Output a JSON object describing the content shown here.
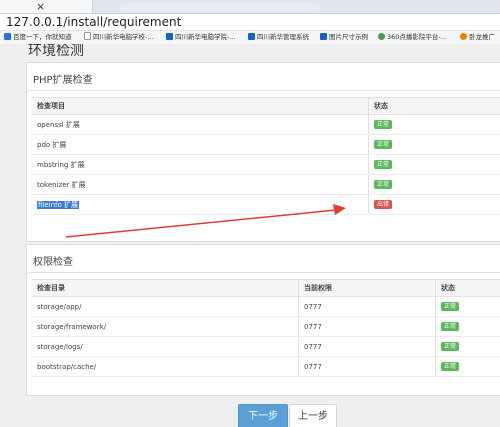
{
  "browser": {
    "url": "127.0.0.1/install/requirement",
    "tab_close": "×",
    "bookmarks": [
      {
        "label": "百度一下，你就知道",
        "color": "#2b6de5"
      },
      {
        "label": "四川新华电脑学校-...",
        "color": "#999999"
      },
      {
        "label": "四川新华电脑学院-...",
        "color": "#1565c0"
      },
      {
        "label": "四川新华管理系统",
        "color": "#1565c0"
      },
      {
        "label": "图片尺寸示例",
        "color": "#1565c0"
      },
      {
        "label": "360点播影院平台-...",
        "color": "#43a047"
      },
      {
        "label": "卧龙推广",
        "color": "#f57c00"
      }
    ]
  },
  "page": {
    "title": "环境检测",
    "php_section": {
      "title": "PHP扩展检查",
      "columns": [
        "检查项目",
        "状态"
      ],
      "rows": [
        {
          "name": "openssl 扩展",
          "status": "正常",
          "state": "ok"
        },
        {
          "name": "pdo 扩展",
          "status": "正常",
          "state": "ok"
        },
        {
          "name": "mbstring 扩展",
          "status": "正常",
          "state": "ok"
        },
        {
          "name": "tokenizer 扩展",
          "status": "正常",
          "state": "ok"
        },
        {
          "name": "fileinfo 扩展",
          "status": "出错",
          "state": "err"
        }
      ]
    },
    "perm_section": {
      "title": "权限检查",
      "columns": [
        "检查目录",
        "当前权限",
        "状态"
      ],
      "rows": [
        {
          "dir": "storage/app/",
          "perm": "0777",
          "status": "正常"
        },
        {
          "dir": "storage/framework/",
          "perm": "0777",
          "status": "正常"
        },
        {
          "dir": "storage/logs/",
          "perm": "0777",
          "status": "正常"
        },
        {
          "dir": "bootstrap/cache/",
          "perm": "0777",
          "status": "正常"
        }
      ]
    },
    "buttons": {
      "next": "下一步",
      "prev": "上一步"
    }
  },
  "colors": {
    "ok": "#5cb85c",
    "err": "#d9534f",
    "primary": "#5a9fd6",
    "annotation_arrow": "#e53935"
  }
}
